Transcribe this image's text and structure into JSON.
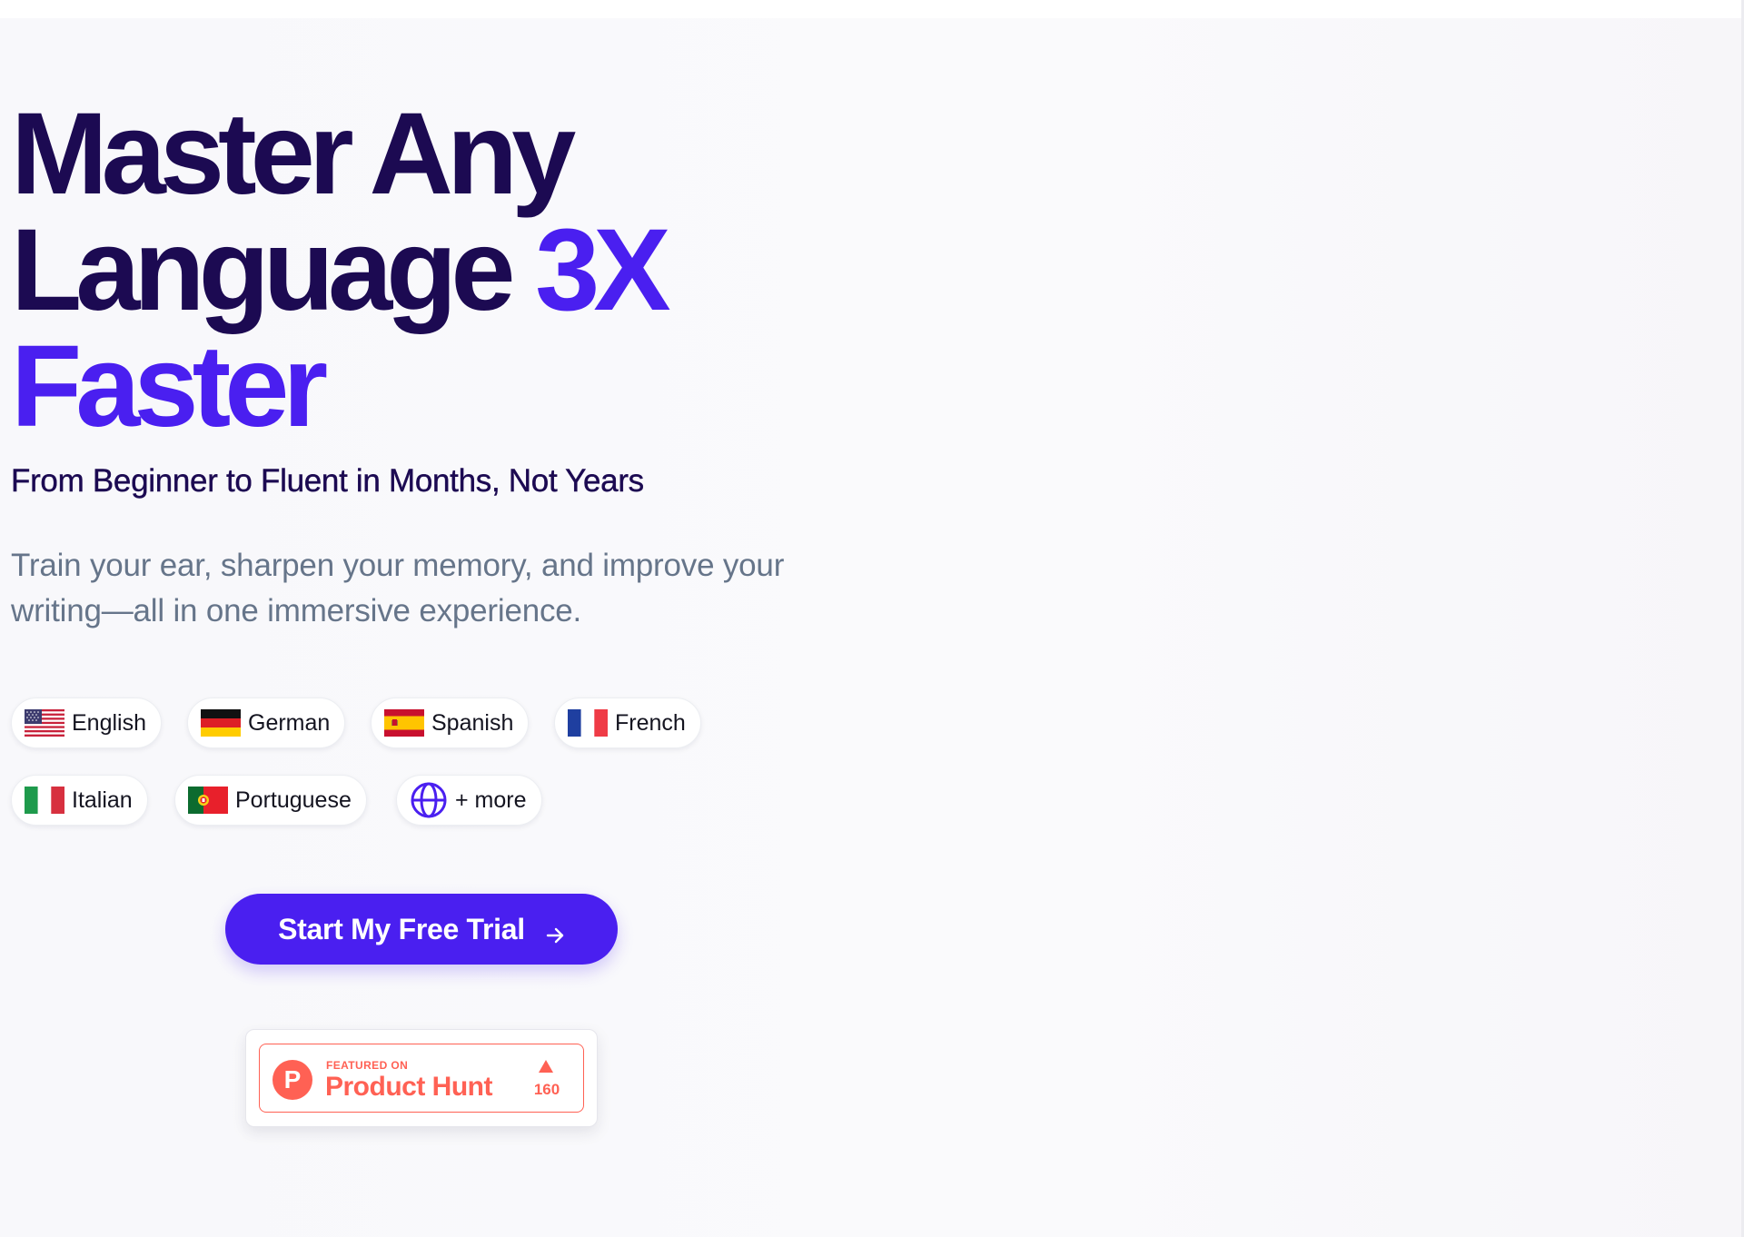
{
  "colors": {
    "brand_dark": "#1c0a52",
    "accent": "#4a1ff0",
    "muted_text": "#66758a",
    "product_hunt": "#ff6154",
    "page_bg": "#f8f8fb"
  },
  "hero": {
    "headline_part1": "Master Any",
    "headline_part2": "Language",
    "headline_accent1": "3X",
    "headline_accent2": "Faster",
    "subheadline": "From Beginner to Fluent in Months, Not Years",
    "description": "Train your ear, sharpen your memory, and improve your writing—all in one immersive experience."
  },
  "languages": [
    {
      "label": "English",
      "icon": "us-flag-icon"
    },
    {
      "label": "German",
      "icon": "germany-flag-icon"
    },
    {
      "label": "Spanish",
      "icon": "spain-flag-icon"
    },
    {
      "label": "French",
      "icon": "france-flag-icon"
    },
    {
      "label": "Italian",
      "icon": "italy-flag-icon"
    },
    {
      "label": "Portuguese",
      "icon": "portugal-flag-icon"
    },
    {
      "label": "+ more",
      "icon": "globe-icon"
    }
  ],
  "cta": {
    "label": "Start My Free Trial",
    "icon": "arrow-right-icon"
  },
  "product_hunt": {
    "featured_label": "FEATURED ON",
    "name": "Product Hunt",
    "logo_letter": "P",
    "upvotes": "160",
    "icon": "upvote-triangle-icon"
  }
}
